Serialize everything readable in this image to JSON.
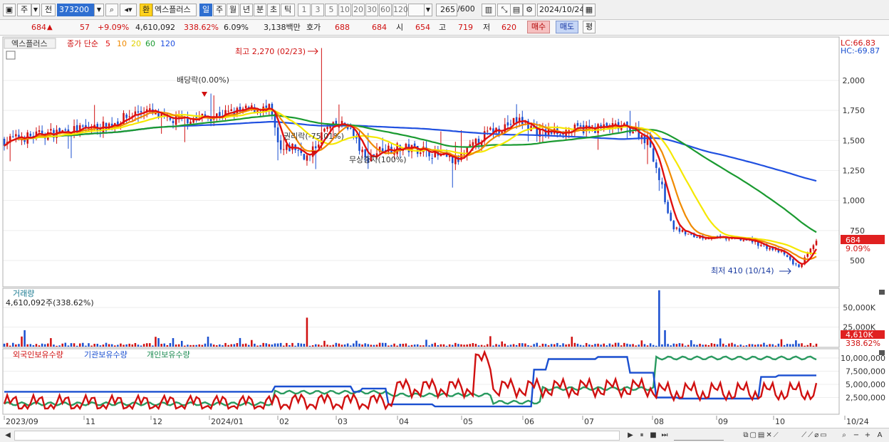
{
  "toolbar": {
    "code": "373200",
    "hwan": "환",
    "stock_name": "엑스플러스",
    "periods": [
      "일",
      "주",
      "월",
      "년",
      "분",
      "초",
      "틱"
    ],
    "selected_period": "일",
    "minute_options": [
      "1",
      "3",
      "5",
      "10",
      "20",
      "30",
      "60",
      "120"
    ],
    "count": "265",
    "count_total": "/600",
    "date": "2024/10/24",
    "left_buttons": [
      "주",
      "전"
    ]
  },
  "quote": {
    "price": "684",
    "change_arrow": "▲",
    "change": "57",
    "change_pct": "+9.09%",
    "volume": "4,610,092",
    "volume_ratio": "338.62%",
    "turnover": "6.09%",
    "amount": "3,138백만",
    "hoga_label": "호가",
    "ask": "688",
    "bid": "684",
    "open_label": "시",
    "open": "654",
    "high_label": "고",
    "high": "719",
    "low_label": "저",
    "low": "620",
    "buy": "매수",
    "sell": "매도",
    "avg": "평"
  },
  "price_pane": {
    "title": "엑스플러스",
    "ma_label": "종가 단순",
    "ma_periods": [
      "5",
      "10",
      "20",
      "60",
      "120"
    ],
    "lc": "LC:66.83",
    "hc": "HC:-69.87",
    "y_ticks": [
      "2,000",
      "1,750",
      "1,500",
      "1,250",
      "1,000",
      "750",
      "500"
    ],
    "current_price": "684",
    "current_pct": "9.09%",
    "annotations": {
      "high": "최고 2,270 (02/23)",
      "low": "최저 410 (10/14)",
      "dividend": "배당락(0.00%)",
      "rights": "권리락(-75.01%)",
      "bonus": "무상증자(100%)"
    }
  },
  "volume_pane": {
    "title": "거래량",
    "value": "4,610,092주(338.62%)",
    "y_ticks": [
      "50,000K",
      "25,000K"
    ],
    "current": "4,610K",
    "current_pct": "338.62%"
  },
  "holding_pane": {
    "legend": [
      "외국인보유수량",
      "기관보유수량",
      "개인보유수량"
    ],
    "y_ticks": [
      "10,000,000",
      "7,500,000",
      "5,000,000",
      "2,500,000"
    ]
  },
  "x_axis": {
    "labels": [
      "2023/09",
      "11",
      "12",
      "2024/01",
      "02",
      "03",
      "04",
      "05",
      "06",
      "07",
      "08",
      "09",
      "10",
      "10/24"
    ]
  },
  "colors": {
    "up": "#d01010",
    "down": "#1a4fd0",
    "ma5": "#e01010",
    "ma10": "#f08a00",
    "ma20": "#f5e800",
    "ma60": "#1a9a30",
    "ma120": "#2050e0"
  }
}
